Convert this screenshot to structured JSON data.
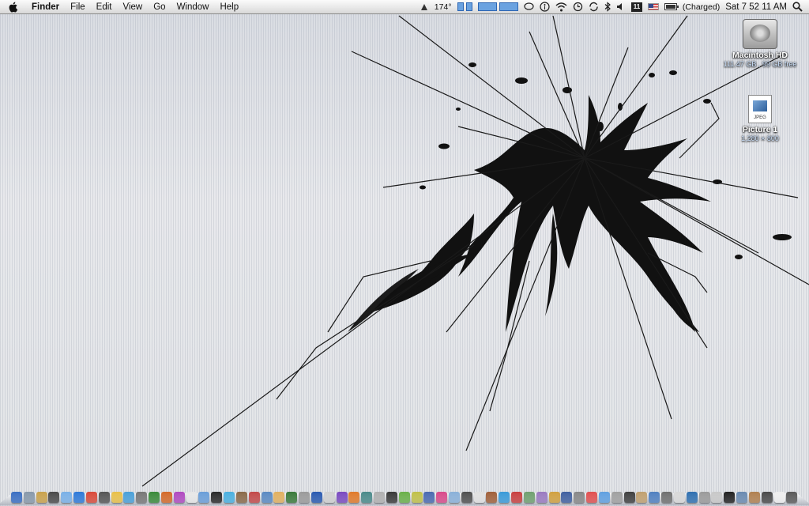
{
  "menubar": {
    "app_name": "Finder",
    "menus": [
      "File",
      "Edit",
      "View",
      "Go",
      "Window",
      "Help"
    ],
    "temperature": "174°",
    "battery_status": "(Charged)",
    "clock": "Sat 7 52 11 AM",
    "calendar_day": "11",
    "status_icons": [
      "weather-icon",
      "cpu-meter-icon",
      "network-graph-icon",
      "speech-bubble-icon",
      "accessibility-icon",
      "wifi-icon",
      "time-machine-icon",
      "sync-icon",
      "bluetooth-icon",
      "volume-icon",
      "calendar-icon",
      "us-flag-icon",
      "battery-icon",
      "spotlight-icon"
    ]
  },
  "desktop_icons": [
    {
      "name": "Macintosh HD",
      "detail": "111.47 GB , 99 GB free",
      "icon": "hard-drive-icon"
    },
    {
      "name": "Picture 1",
      "detail": "1,280 × 800",
      "icon": "jpeg-file-icon",
      "badge": "JPEG"
    }
  ],
  "colors": {
    "wallpaper": "#e2e4e7",
    "menubar": "#e9e9e9",
    "crack_ink": "#111111"
  },
  "dock": {
    "icon_colors": [
      "#3b6fc2",
      "#8899aa",
      "#c9a24d",
      "#4a4a4a",
      "#7ab0e6",
      "#2f7ad8",
      "#d94a3a",
      "#555555",
      "#e8c04a",
      "#4aa0d8",
      "#777777",
      "#3a8a3a",
      "#d36a2a",
      "#b04ac0",
      "#e6e6e6",
      "#6a9ed8",
      "#2a2a2a",
      "#4ab0e0",
      "#8a6a4a",
      "#c24a4a",
      "#5a8ac2",
      "#e0b060",
      "#3a7a3a",
      "#9a9a9a",
      "#2a5ab0",
      "#d0d0d0",
      "#7a4ac0",
      "#e07a2a",
      "#4a8a8a",
      "#b0b0b0",
      "#3a3a3a",
      "#6ab04a",
      "#c0c04a",
      "#4a6ab0",
      "#d84a8a",
      "#8ab0d8",
      "#505050",
      "#e0e0e0",
      "#a0603a",
      "#3a9ad8",
      "#c84040",
      "#70a070",
      "#9a7ac0",
      "#d0a040",
      "#4060a0",
      "#888888",
      "#e05050",
      "#60a0e0",
      "#a0a0a0",
      "#404040",
      "#c0a070",
      "#5080c0",
      "#707070",
      "#d8d8d8",
      "#3070b0",
      "#9a9a9a",
      "#c8c8c8",
      "#222222",
      "#6a8ab0",
      "#b08050",
      "#4a4a4a",
      "#eeeeee",
      "#5a5a5a"
    ]
  }
}
